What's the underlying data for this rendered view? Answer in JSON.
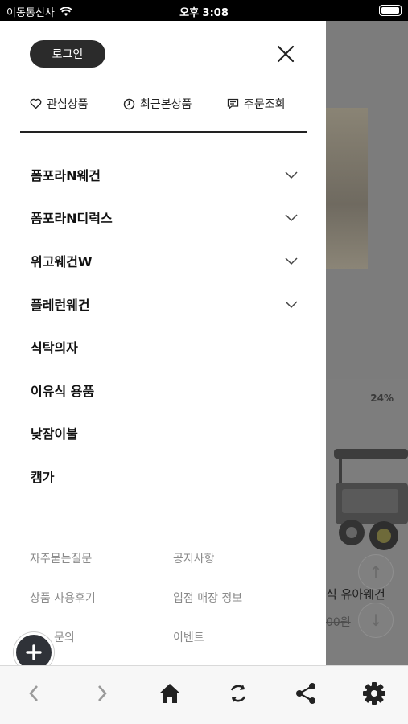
{
  "status_bar": {
    "carrier": "이동통신사",
    "time": "오후 3:08"
  },
  "drawer": {
    "login_label": "로그인",
    "quick_links": [
      {
        "label": "관심상품",
        "icon": "heart-icon"
      },
      {
        "label": "최근본상품",
        "icon": "clock-icon"
      },
      {
        "label": "주문조회",
        "icon": "receipt-icon"
      }
    ],
    "menu": [
      {
        "label": "폼포라N웨건",
        "expandable": true
      },
      {
        "label": "폼포라N디럭스",
        "expandable": true
      },
      {
        "label": "위고웨건W",
        "expandable": true
      },
      {
        "label": "플레런웨건",
        "expandable": true
      },
      {
        "label": "식탁의자",
        "expandable": false
      },
      {
        "label": "이유식 용품",
        "expandable": false
      },
      {
        "label": "낮잠이불",
        "expandable": false
      },
      {
        "label": "캠가",
        "expandable": false
      }
    ],
    "footer_links": [
      {
        "label": "자주묻는질문"
      },
      {
        "label": "공지사항"
      },
      {
        "label": "상품 사용후기"
      },
      {
        "label": "입점 매장 정보"
      },
      {
        "label": "문의"
      },
      {
        "label": "이벤트"
      }
    ]
  },
  "background_page": {
    "discount_badge": "24%",
    "product_name": "식 유아웨건",
    "product_price": "00원"
  },
  "toolbar": {
    "items": [
      "back-icon",
      "forward-icon",
      "home-icon",
      "refresh-icon",
      "share-icon",
      "settings-icon"
    ]
  },
  "colors": {
    "accent_dark": "#2b2b2b",
    "overlay": "#7c7c7c",
    "muted_text": "#8a8a8a"
  }
}
